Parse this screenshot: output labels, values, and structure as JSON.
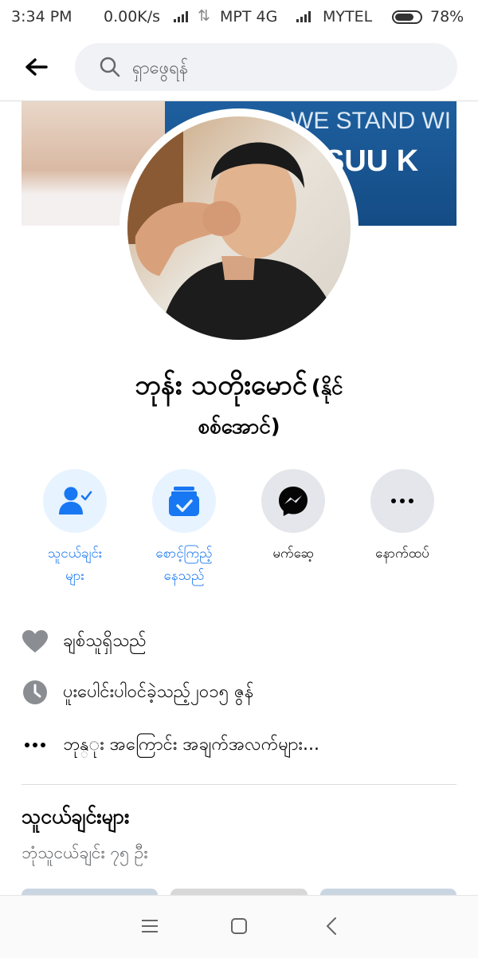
{
  "status": {
    "time": "3:34 PM",
    "speed": "0.00K/s",
    "carrier1": "MPT 4G",
    "carrier2": "MYTEL",
    "battery": "78%",
    "battery_level": 0.78
  },
  "header": {
    "search_placeholder": "ရှာဖွေရန်"
  },
  "cover": {
    "text_line1": "WE STAND WI",
    "text_line2": "SUU K"
  },
  "profile": {
    "name_main": "ဘုန်း သတိုးမောင်",
    "name_sub_part1": "(နိုင်",
    "name_sub_part2": "စစ်အောင်)"
  },
  "actions": [
    {
      "label": "သူငယ်ချင်း\nများ",
      "icon": "friend-check-icon"
    },
    {
      "label": "စောင့်ကြည့်\nနေသည်",
      "icon": "following-check-icon"
    },
    {
      "label": "မက်ဆေ့",
      "icon": "messenger-icon"
    },
    {
      "label": "နောက်ထပ်",
      "icon": "more-icon"
    }
  ],
  "info": {
    "relationship": "ချစ်သူရှိသည်",
    "joined": "ပူးပေါင်းပါဝင်ခဲ့သည့်၂၀၁၅ ဇွန်",
    "about": "ဘုန္ုး အကြောင်း အချက်အလက်များ..."
  },
  "friends": {
    "title": "သူငယ်ချင်းများ",
    "count_text": "ဘုံသူငယ်ချင်း ၇၅ ဦး"
  },
  "colors": {
    "accent": "#1877f2",
    "light_accent": "#e7f3ff",
    "grey_button": "#e4e6eb",
    "secondary_text": "#65676b"
  }
}
